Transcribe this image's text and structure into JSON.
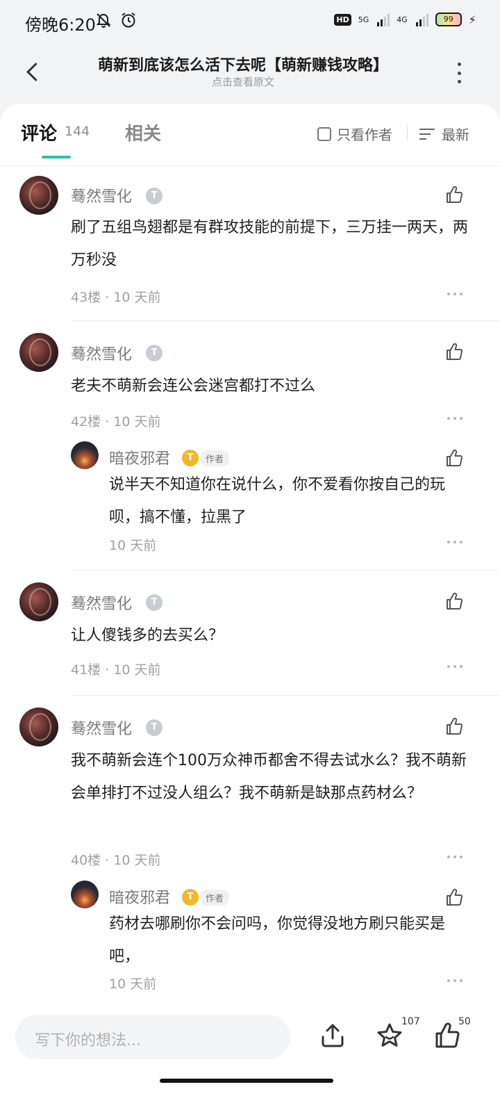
{
  "status_bar": {
    "time": "傍晚6:20",
    "hd": "HD",
    "net1": "5G",
    "net2": "4G",
    "battery": "99"
  },
  "nav": {
    "title": "萌新到底该怎么活下去呢【萌新赚钱攻略】",
    "subtitle": "点击查看原文"
  },
  "tabs": {
    "comments_label": "评论",
    "comments_count": "144",
    "related_label": "相关",
    "only_author": "只看作者",
    "sort": "最新"
  },
  "comments": [
    {
      "name": "蓦然雪化",
      "badge": "T",
      "text": "刷了五组鸟翅都是有群攻技能的前提下，三万挂一两天，两万秒没",
      "floor": "43楼",
      "time": "10 天前"
    },
    {
      "name": "蓦然雪化",
      "badge": "T",
      "text": "老夫不萌新会连公会迷宫都打不过么",
      "floor": "42楼",
      "time": "10 天前",
      "reply": {
        "name": "暗夜邪君",
        "badge": "T",
        "tag": "作者",
        "text": "说半天不知道你在说什么，你不爱看你按自己的玩呗，搞不懂，拉黑了",
        "time": "10 天前"
      }
    },
    {
      "name": "蓦然雪化",
      "badge": "T",
      "text": "让人傻钱多的去买么？",
      "floor": "41楼",
      "time": "10 天前"
    },
    {
      "name": "蓦然雪化",
      "badge": "T",
      "text": "我不萌新会连个100万众神币都舍不得去试水么？我不萌新会单排打不过没人组么？我不萌新是缺那点药材么？",
      "floor": "40楼",
      "time": "10 天前",
      "reply": {
        "name": "暗夜邪君",
        "badge": "T",
        "tag": "作者",
        "text": "药材去哪刷你不会问吗，你觉得没地方刷只能买是吧，",
        "time": "10 天前"
      }
    }
  ],
  "bottom_bar": {
    "input_placeholder": "写下你的想法...",
    "star_count": "107",
    "like_count": "50"
  },
  "colors": {
    "accent": "#2dbfa8",
    "author_badge": "#f2b72a"
  },
  "icons": [
    "back-icon",
    "more-icon",
    "checkbox-icon",
    "sort-icon",
    "like-icon",
    "dots-icon",
    "share-icon",
    "star-icon"
  ]
}
